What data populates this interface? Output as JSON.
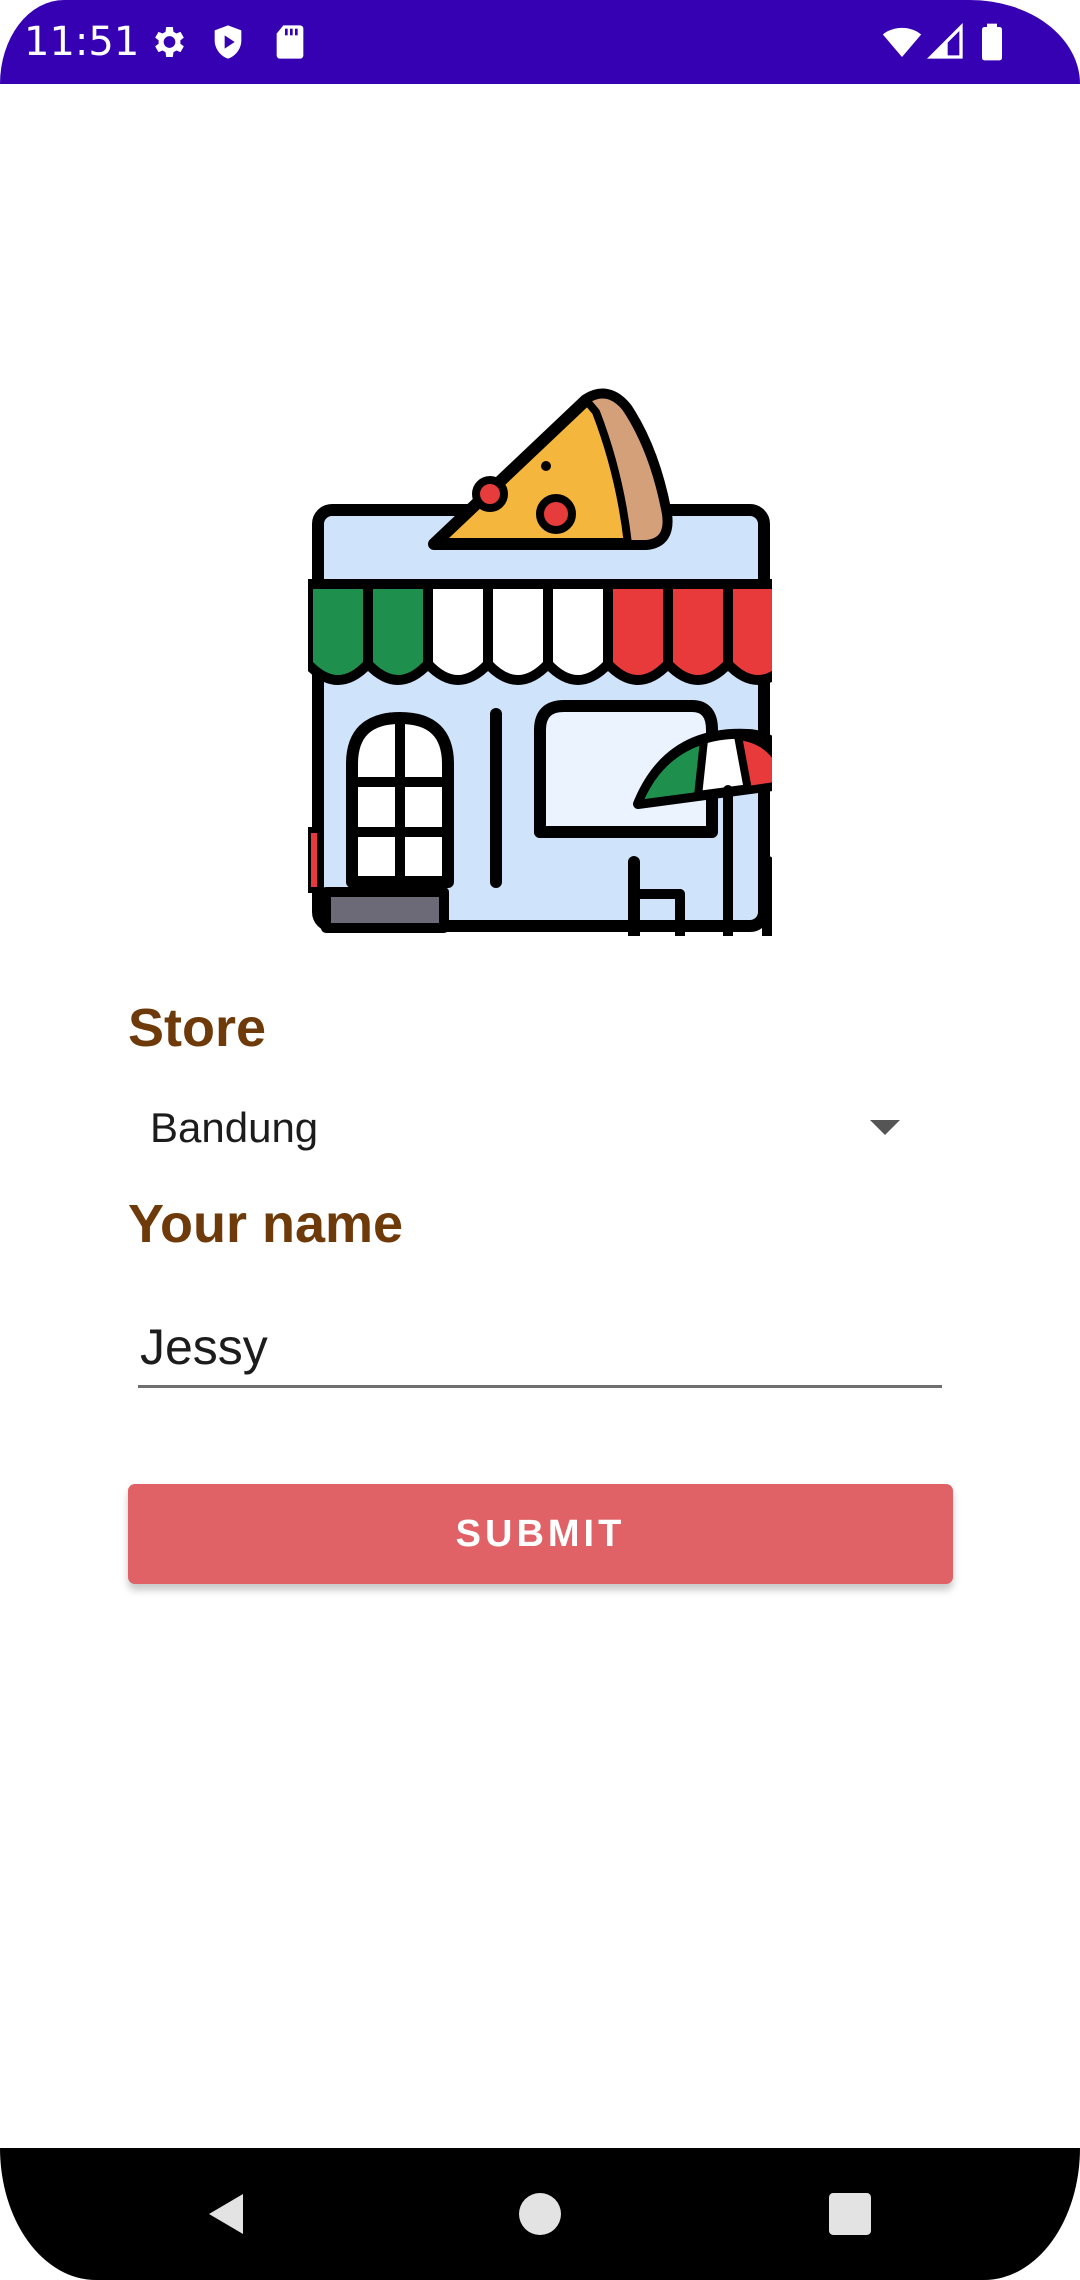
{
  "status_bar": {
    "time": "11:51",
    "left_icons": [
      "gear-icon",
      "shield-play-icon",
      "sd-card-icon"
    ],
    "right_icons": [
      "wifi-icon",
      "cell-signal-icon",
      "battery-icon"
    ],
    "background_color": "#3600b3"
  },
  "illustration": {
    "icon": "pizza-store-icon"
  },
  "form": {
    "store_label": "Store",
    "store_selected": "Bandung",
    "name_label": "Your name",
    "name_value": "Jessy",
    "submit_label": "SUBMIT"
  },
  "colors": {
    "label": "#6e3a0a",
    "button": "#e06266",
    "status_bar": "#3600b3"
  },
  "nav_bar": {
    "icons": [
      "back-icon",
      "home-icon",
      "recents-icon"
    ]
  }
}
